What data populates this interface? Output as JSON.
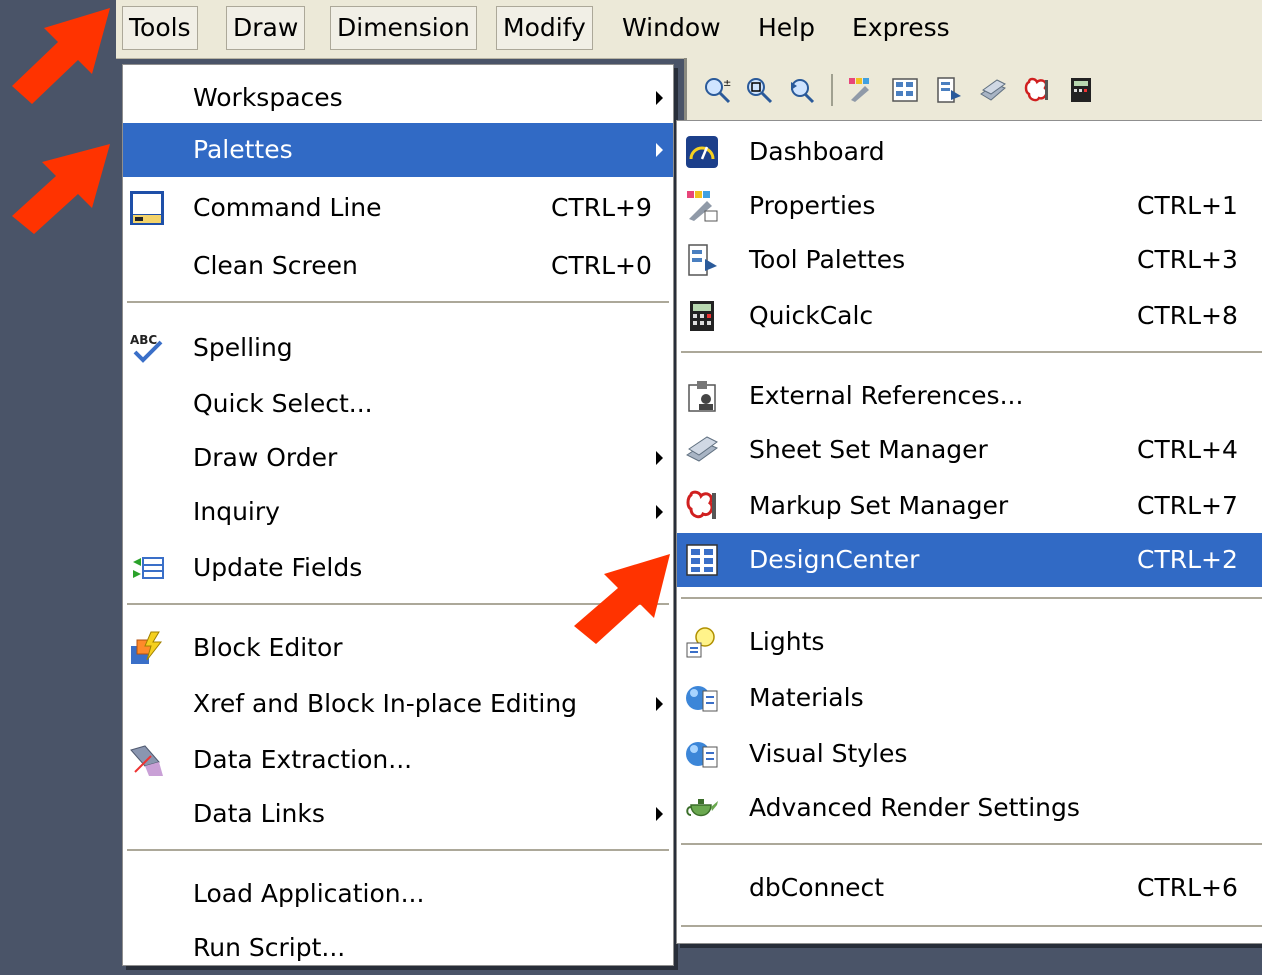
{
  "menubar": {
    "items": [
      "Tools",
      "Draw",
      "Dimension",
      "Modify",
      "Window",
      "Help",
      "Express"
    ]
  },
  "tools_menu": {
    "workspaces": "Workspaces",
    "palettes": "Palettes",
    "command_line": "Command Line",
    "command_line_shortcut": "CTRL+9",
    "clean_screen": "Clean Screen",
    "clean_screen_shortcut": "CTRL+0",
    "spelling": "Spelling",
    "quick_select": "Quick Select...",
    "draw_order": "Draw Order",
    "inquiry": "Inquiry",
    "update_fields": "Update Fields",
    "block_editor": "Block Editor",
    "xref_block_editing": "Xref and Block In-place Editing",
    "data_extraction": "Data Extraction...",
    "data_links": "Data Links",
    "load_application": "Load Application...",
    "run_script": "Run Script..."
  },
  "palettes_menu": {
    "dashboard": "Dashboard",
    "properties": "Properties",
    "properties_shortcut": "CTRL+1",
    "tool_palettes": "Tool Palettes",
    "tool_palettes_shortcut": "CTRL+3",
    "quickcalc": "QuickCalc",
    "quickcalc_shortcut": "CTRL+8",
    "external_references": "External References...",
    "sheet_set_manager": "Sheet Set Manager",
    "sheet_set_manager_shortcut": "CTRL+4",
    "markup_set_manager": "Markup Set Manager",
    "markup_set_manager_shortcut": "CTRL+7",
    "designcenter": "DesignCenter",
    "designcenter_shortcut": "CTRL+2",
    "lights": "Lights",
    "materials": "Materials",
    "visual_styles": "Visual Styles",
    "advanced_render_settings": "Advanced Render Settings",
    "dbconnect": "dbConnect",
    "dbconnect_shortcut": "CTRL+6"
  },
  "colors": {
    "selection": "#316ac5",
    "annotation_arrow": "#ff3300",
    "background": "#4a5468"
  }
}
